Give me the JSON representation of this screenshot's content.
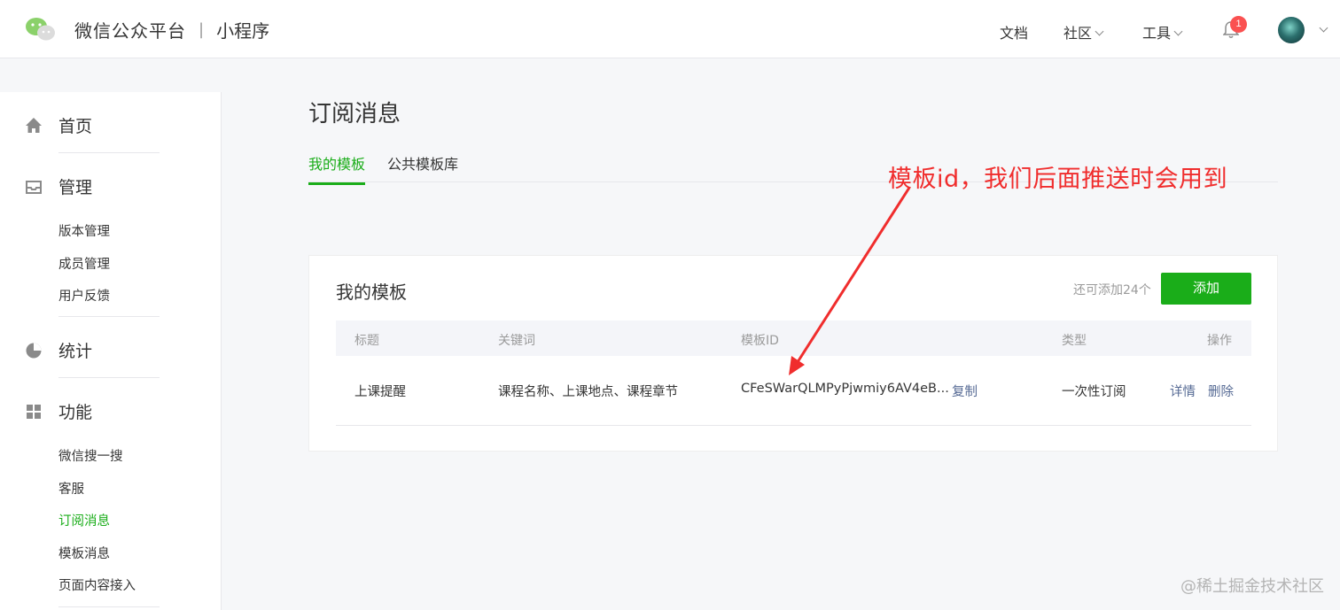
{
  "header": {
    "brand": "微信公众平台",
    "separator": "|",
    "product": "小程序",
    "nav": {
      "docs": "文档",
      "community": "社区",
      "tools": "工具"
    },
    "notification_count": "1"
  },
  "sidebar": {
    "sections": [
      {
        "label": "首页",
        "icon": "home-icon"
      },
      {
        "label": "管理",
        "icon": "inbox-icon",
        "items": [
          "版本管理",
          "成员管理",
          "用户反馈"
        ]
      },
      {
        "label": "统计",
        "icon": "pie-chart-icon"
      },
      {
        "label": "功能",
        "icon": "grid-icon",
        "items": [
          "微信搜一搜",
          "客服",
          "订阅消息",
          "模板消息",
          "页面内容接入"
        ]
      }
    ],
    "active_item": "订阅消息"
  },
  "main": {
    "title": "订阅消息",
    "tabs": [
      "我的模板",
      "公共模板库"
    ],
    "active_tab": "我的模板",
    "card": {
      "title": "我的模板",
      "remaining_text": "还可添加24个",
      "add_label": "添加",
      "columns": [
        "标题",
        "关键词",
        "模板ID",
        "类型",
        "操作"
      ],
      "rows": [
        {
          "title": "上课提醒",
          "keywords": "课程名称、上课地点、课程章节",
          "template_id": "CFeSWarQLMPyPjwmiy6AV4eB...",
          "copy_label": "复制",
          "type": "一次性订阅",
          "actions": [
            "详情",
            "删除"
          ]
        }
      ]
    }
  },
  "annotation": {
    "text": "模板id，我们后面推送时会用到",
    "color": "#f02d2d"
  },
  "watermark": "@稀土掘金技术社区",
  "colors": {
    "accent": "#1aad19",
    "link": "#576b95"
  }
}
